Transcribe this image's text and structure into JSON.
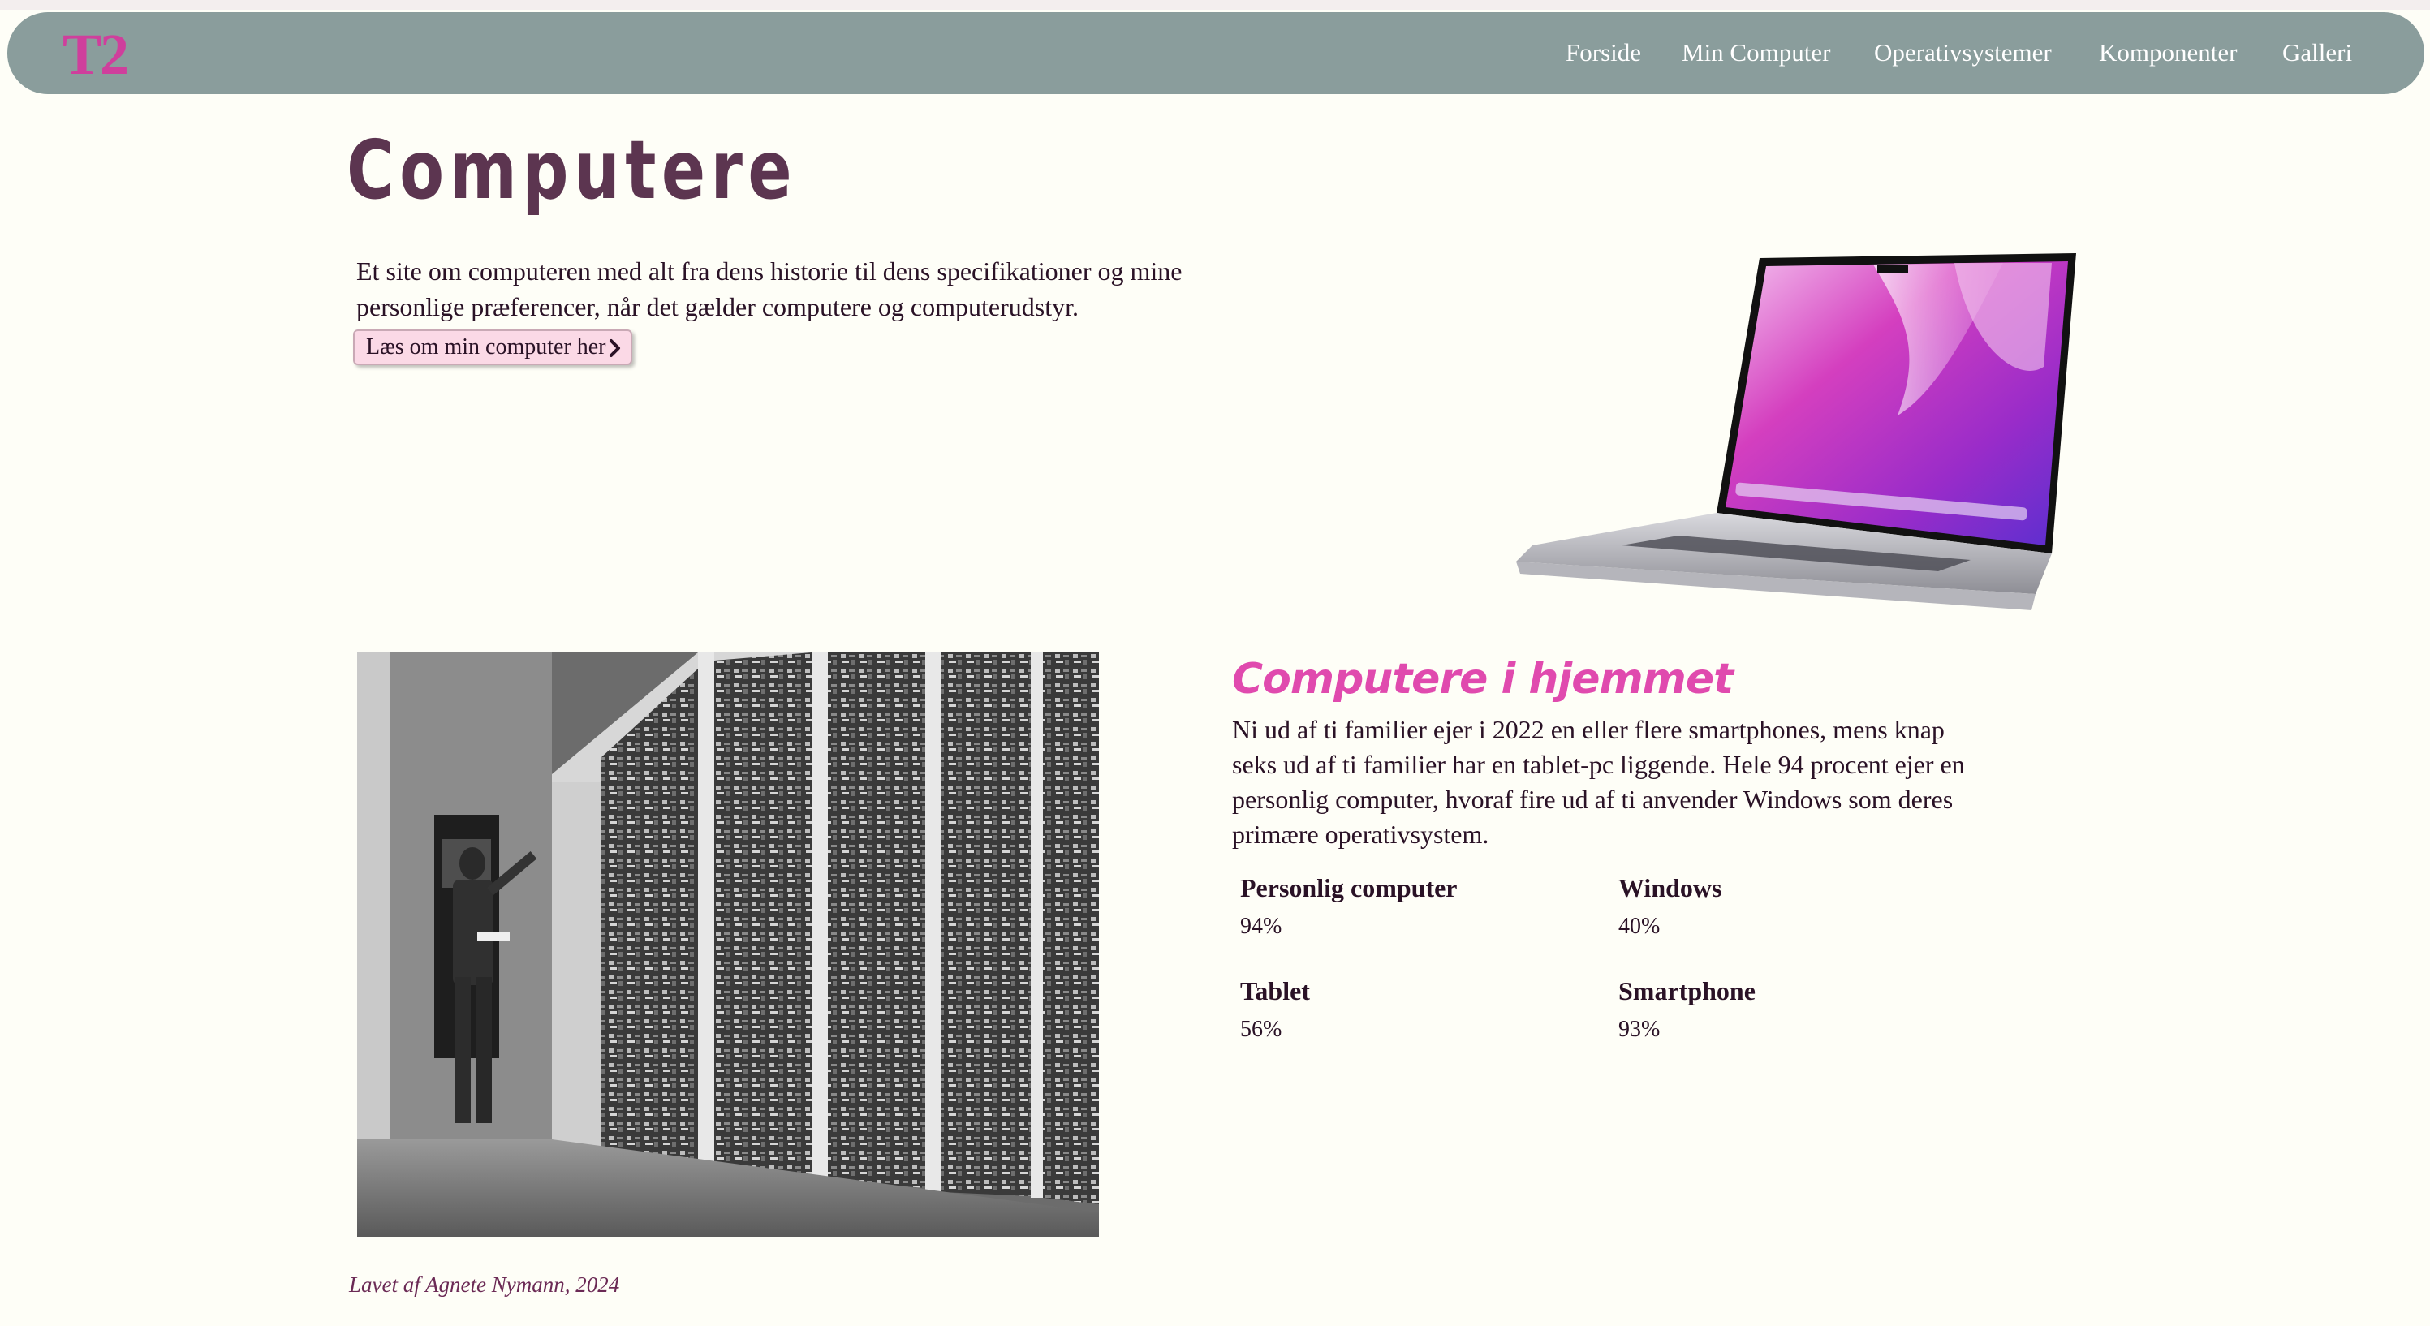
{
  "header": {
    "logo": "T2",
    "nav": [
      "Forside",
      "Min Computer",
      "Operativsystemer",
      "Komponenter",
      "Galleri"
    ]
  },
  "hero": {
    "title": "Computere",
    "intro": "Et site om computeren med alt fra dens historie til dens specifikationer og mine personlige præferencer, når det gælder computere og computerudstyr.",
    "button_label": "Læs om min computer her"
  },
  "home_section": {
    "heading": "Computere i hjemmet",
    "text": "Ni ud af ti familier ejer i 2022 en eller flere smartphones, mens knap seks ud af ti familier har en tablet-pc liggende. Hele 94 procent ejer en personlig computer, hvoraf fire ud af ti anvender Windows som deres primære operativsystem.",
    "stats": [
      {
        "label": "Personlig computer",
        "value": "94%"
      },
      {
        "label": "Windows",
        "value": "40%"
      },
      {
        "label": "Tablet",
        "value": "56%"
      },
      {
        "label": "Smartphone",
        "value": "93%"
      }
    ]
  },
  "footer": {
    "credit": "Lavet af Agnete Nymann, 2024"
  },
  "colors": {
    "background": "#fefef7",
    "navbar": "#8a9d9c",
    "logo": "#cf3f9c",
    "title": "#5c3550",
    "accent_heading": "#e04aae",
    "button_bg": "#fbd9e6",
    "text": "#2a1226"
  },
  "icons": {
    "button_chevron": "chevron-right-icon"
  }
}
